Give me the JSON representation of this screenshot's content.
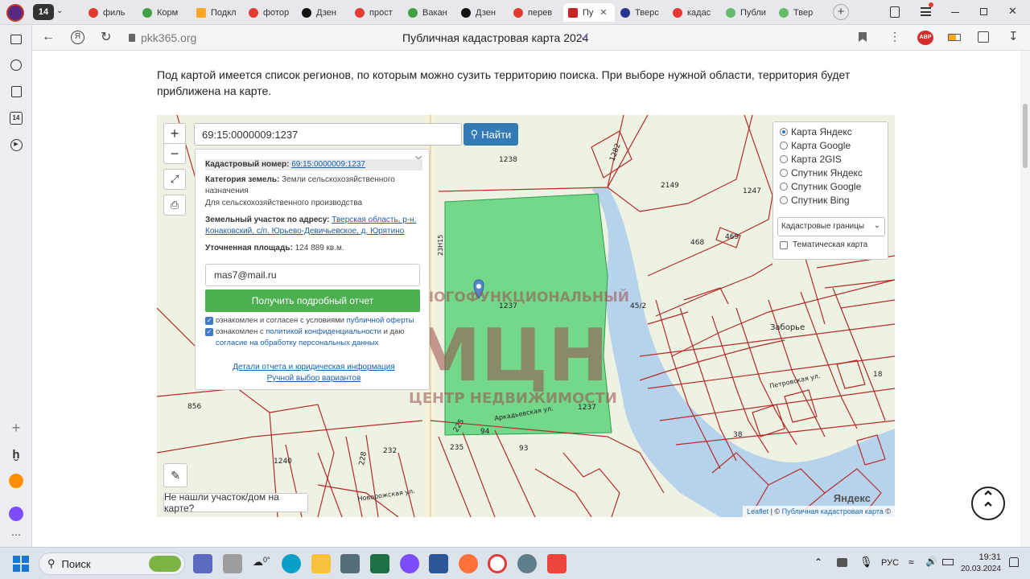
{
  "browser": {
    "tab_count": "14",
    "tabs": [
      {
        "label": "филь",
        "color": "#e53935"
      },
      {
        "label": "Корм",
        "color": "#43a047"
      },
      {
        "label": "Подкл",
        "color": "#f9a825"
      },
      {
        "label": "фотор",
        "color": "#e53935"
      },
      {
        "label": "Дзен",
        "color": "#111111"
      },
      {
        "label": "прост",
        "color": "#e53935"
      },
      {
        "label": "Вакан",
        "color": "#43a047"
      },
      {
        "label": "Дзен",
        "color": "#111111"
      },
      {
        "label": "перев",
        "color": "#e53935"
      },
      {
        "label": "Пу",
        "color": "#c62828"
      },
      {
        "label": "Тверс",
        "color": "#283593"
      },
      {
        "label": "кадас",
        "color": "#e53935"
      },
      {
        "label": "Публи",
        "color": "#66bb6a"
      },
      {
        "label": "Твер",
        "color": "#66bb6a"
      }
    ],
    "url": "pkk365.org",
    "page_title": "Публичная кадастровая карта 2024",
    "badge": "АВР"
  },
  "page": {
    "intro": "Под картой имеется список регионов, по которым можно сузить территорию поиска. При выборе нужной области, территория будет приближена на карте."
  },
  "map": {
    "search_value": "69:15:0000009:1237",
    "find_label": "Найти",
    "popup": {
      "cad_label": "Кадастровый номер:",
      "cad_value": "69:15:0000009:1237",
      "cat_label": "Категория земель:",
      "cat_value": "Земли сельскохозяйственного назначения",
      "use": "Для сельскохозяйственного производства",
      "addr_label": "Земельный участок по адресу:",
      "addr_value": "Тверская область, р-н. Конаковский, с/п. Юрьево-Девичьевское, д. Юрятино",
      "area_label": "Уточненная площадь:",
      "area_value": "124 889 кв.м.",
      "email": "mas7@mail.ru",
      "report_button": "Получить подробный отчет",
      "check1_text": "ознакомлен и согласен с условиями",
      "check1_link": "публичной оферты",
      "check2_text": "ознакомлен с",
      "check2_link": "политикой конфиденциальности",
      "check2_text2": "и даю",
      "check2_link2": "согласие на обработку персональных данных",
      "details_link": "Детали отчета и юридическая информация",
      "manual_link": "Ручной выбор вариантов"
    },
    "layers": [
      {
        "label": "Карта Яндекс",
        "selected": true
      },
      {
        "label": "Карта Google",
        "selected": false
      },
      {
        "label": "Карта 2GIS",
        "selected": false
      },
      {
        "label": "Спутник Яндекс",
        "selected": false
      },
      {
        "label": "Спутник Google",
        "selected": false
      },
      {
        "label": "Спутник Bing",
        "selected": false
      }
    ],
    "layer_select": "Кадастровые границы",
    "thematic": "Тематическая карта",
    "not_found": "Не нашли участок/дом на карте?",
    "attribution_link1": "Leaflet",
    "attribution_sep": "| ©",
    "attribution_link2": "Публичная кадастровая карта",
    "attribution_end": "©",
    "yandex": "Яндекс",
    "watermark_top": "МНОГОФУНКЦИОНАЛЬНЫЙ",
    "watermark_main": "МЦН",
    "watermark_bottom": "ЦЕНТР НЕДВИЖИМОСТИ",
    "labels": {
      "l1238": "1238",
      "l1282": "1282",
      "l2149": "2149",
      "l1247": "1247",
      "l468": "468",
      "l469": "469",
      "l1237a": "1237",
      "l1237b": "1237",
      "l452": "45/2",
      "l856": "856",
      "l1240": "1240",
      "l94": "94",
      "l93": "93",
      "l225": "225",
      "l235": "235",
      "l232": "232",
      "l228": "228",
      "l38": "38",
      "l18": "18",
      "lzab": "Заборье",
      "lpetr": "Петровская ул.",
      "larkad": "Аркадьевская ул.",
      "lnov": "Новорожская ул.",
      "lroad": "23Н15"
    }
  },
  "taskbar": {
    "search_label": "Поиск",
    "weather": "0°",
    "lang": "РУС",
    "time": "19:31",
    "date": "20.03.2024"
  }
}
